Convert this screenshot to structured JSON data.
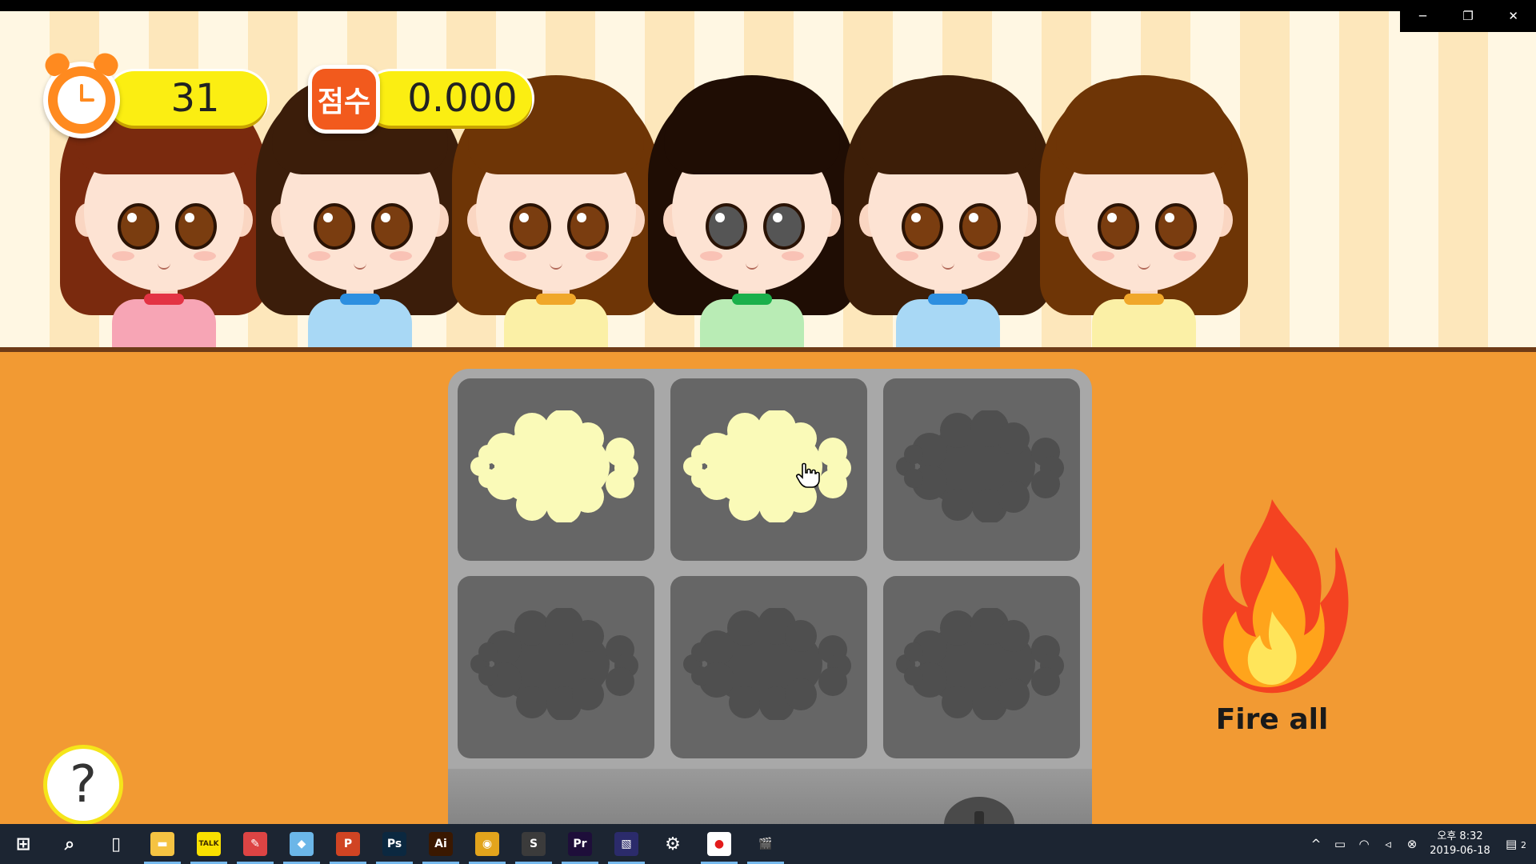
{
  "window": {
    "minimize": "─",
    "restore": "❐",
    "close": "✕"
  },
  "hud": {
    "timer_value": "31",
    "score_label": "점수",
    "score_value": "0.000"
  },
  "kids": [
    {
      "hair": "#7a2a0e",
      "skin": "#fde3d3",
      "shirt": "#f7a5b5",
      "collar": "#e33344",
      "eyes": "#7a3d10"
    },
    {
      "hair": "#3b1d0a",
      "skin": "#fde3d3",
      "shirt": "#a8d8f5",
      "collar": "#2d8fe0",
      "eyes": "#7a3d10"
    },
    {
      "hair": "#6e3506",
      "skin": "#fde3d3",
      "shirt": "#fbf0a6",
      "collar": "#f0a72a",
      "eyes": "#7a3d10"
    },
    {
      "hair": "#1f0d04",
      "skin": "#fde3d3",
      "shirt": "#b9ecb5",
      "collar": "#1bb04b",
      "eyes": "#555555"
    },
    {
      "hair": "#3d1e08",
      "skin": "#fde3d3",
      "shirt": "#a8d8f5",
      "collar": "#2d8fe0",
      "eyes": "#7a3d10"
    },
    {
      "hair": "#6e3506",
      "skin": "#fde3d3",
      "shirt": "#fbf0a6",
      "collar": "#f0a72a",
      "eyes": "#7a3d10"
    }
  ],
  "grill": {
    "slots": [
      {
        "state": "batter",
        "color": "#fafab8"
      },
      {
        "state": "batter",
        "color": "#fafab8"
      },
      {
        "state": "empty",
        "color": "#4f4f4f"
      },
      {
        "state": "empty",
        "color": "#4f4f4f"
      },
      {
        "state": "empty",
        "color": "#4f4f4f"
      },
      {
        "state": "empty",
        "color": "#4f4f4f"
      }
    ]
  },
  "fire_button": {
    "label": "Fire all"
  },
  "help_button": {
    "label": "?"
  },
  "taskbar": {
    "apps": [
      {
        "name": "start-icon",
        "glyph": "⊞",
        "bg": "transparent"
      },
      {
        "name": "search-icon",
        "glyph": "⌕",
        "bg": "transparent"
      },
      {
        "name": "task-view-icon",
        "glyph": "▯",
        "bg": "transparent"
      },
      {
        "name": "file-explorer-icon",
        "glyph": "▬",
        "bg": "#f5c342"
      },
      {
        "name": "kakaotalk-icon",
        "glyph": "TALK",
        "bg": "#f9e000"
      },
      {
        "name": "paint-icon",
        "glyph": "✎",
        "bg": "#d44"
      },
      {
        "name": "notepad-icon",
        "glyph": "◆",
        "bg": "#6bb6e8"
      },
      {
        "name": "powerpoint-icon",
        "glyph": "P",
        "bg": "#d04423"
      },
      {
        "name": "photoshop-icon",
        "glyph": "Ps",
        "bg": "#0b2840"
      },
      {
        "name": "illustrator-icon",
        "glyph": "Ai",
        "bg": "#3a1800"
      },
      {
        "name": "chrome-icon",
        "glyph": "◉",
        "bg": "#e2a41c"
      },
      {
        "name": "sublime-icon",
        "glyph": "S",
        "bg": "#3b3b3b"
      },
      {
        "name": "premiere-icon",
        "glyph": "Pr",
        "bg": "#1e0e3a"
      },
      {
        "name": "vegas-icon",
        "glyph": "▧",
        "bg": "#2b2b6b"
      },
      {
        "name": "settings-icon",
        "glyph": "⚙",
        "bg": "transparent"
      },
      {
        "name": "recorder-icon",
        "glyph": "●",
        "bg": "#ffffff"
      },
      {
        "name": "clapper-icon",
        "glyph": "🎬",
        "bg": "transparent"
      }
    ],
    "time_ampm": "오후 8:32",
    "date": "2019-06-18",
    "notif_count": "2"
  }
}
